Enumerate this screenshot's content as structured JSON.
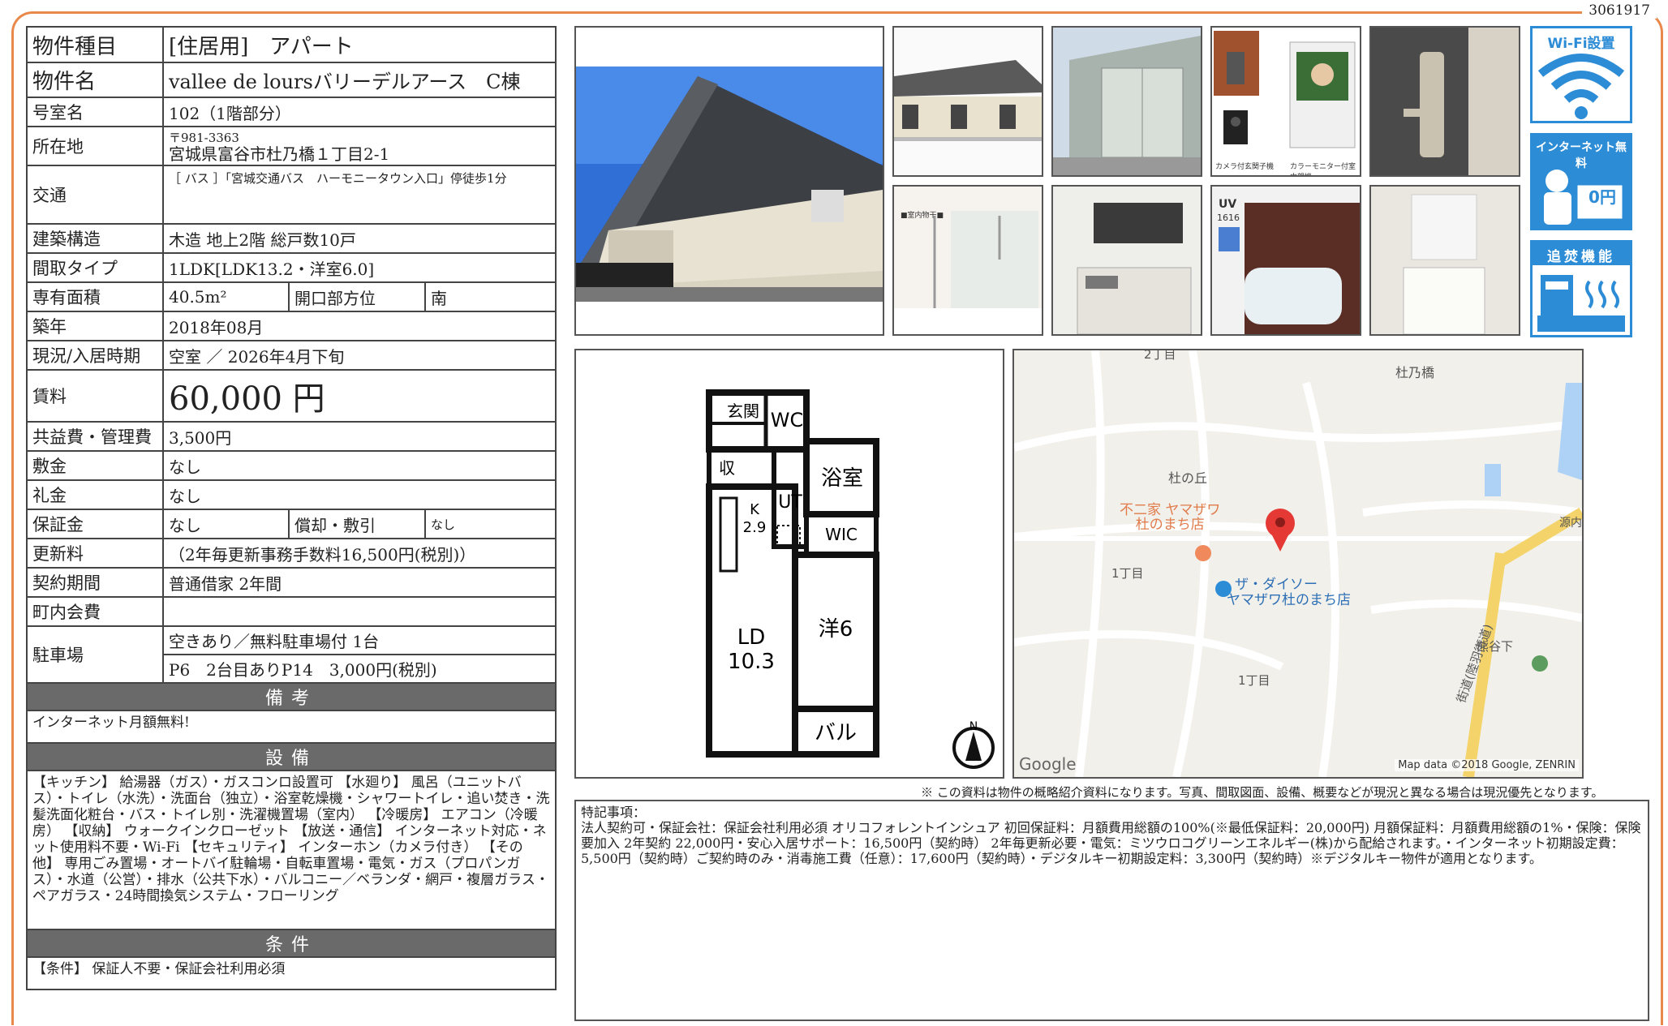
{
  "doc_id": "3061917",
  "labels": {
    "type": "物件種目",
    "name": "物件名",
    "room": "号室名",
    "address": "所在地",
    "transit": "交通",
    "structure": "建築構造",
    "layout": "間取タイプ",
    "area": "専有面積",
    "opening_dir": "開口部方位",
    "built": "築年",
    "status": "現況/入居時期",
    "rent": "賃料",
    "common_fee": "共益費・管理費",
    "deposit": "敷金",
    "key_money": "礼金",
    "guarantee": "保証金",
    "depreciation": "償却・敷引",
    "renewal": "更新料",
    "contract": "契約期間",
    "town_fee": "町内会費",
    "parking": "駐車場"
  },
  "values": {
    "type": "[住居用]　アパート",
    "name": "vallee de loursバリーデルアース　C棟",
    "room": "102（1階部分）",
    "postal": "〒981-3363",
    "address": "宮城県富谷市杜乃橋１丁目2-1",
    "transit": "［ バス ］「宮城交通バス　ハーモニータウン入口」停徒歩1分",
    "structure": "木造 地上2階 総戸数10戸",
    "layout": "1LDK[LDK13.2・洋室6.0]",
    "area": "40.5m²",
    "opening_dir": "南",
    "built": "2018年08月",
    "status": "空室 ／ 2026年4月下旬",
    "rent": "60,000 円",
    "common_fee": "3,500円",
    "deposit": "なし",
    "key_money": "なし",
    "guarantee": "なし",
    "depreciation": "なし",
    "renewal": "（2年毎更新事務手数料16,500円(税別)）",
    "contract": "普通借家 2年間",
    "town_fee": "",
    "parking_1": "空きあり／無料駐車場付 1台",
    "parking_2": "P6　2台目ありP14　3,000円(税別)"
  },
  "sections": {
    "remarks_title": "備考",
    "remarks": "インターネット月額無料!",
    "equipment_title": "設備",
    "equipment": "【キッチン】 給湯器（ガス）・ガスコンロ設置可 【水廻り】 風呂（ユニットバス）・トイレ（水洗）・洗面台（独立）・浴室乾燥機・シャワートイレ・追い焚き・洗髪洗面化粧台・バス・トイレ別・洗濯機置場（室内） 【冷暖房】 エアコン（冷暖房） 【収納】 ウォークインクローゼット 【放送・通信】 インターネット対応・ネット使用料不要・Wi-Fi 【セキュリティ】 インターホン（カメラ付き） 【その他】 専用ごみ置場・オートバイ駐輪場・自転車置場・電気・ガス（プロパンガス）・水道（公営）・排水（公共下水）・バルコニー／ベランダ・網戸・複層ガラス・ペアガラス・24時間換気システム・フローリング",
    "conditions_title": "条件",
    "conditions": "【条件】 保証人不要・保証会社利用必須"
  },
  "badges": {
    "wifi": "Wi-Fi設置",
    "internet": "インターネット無料",
    "internet_price": "0円",
    "reheat": "追焚機能"
  },
  "photo_captions": {
    "intercom_left": "カメラ付玄関子機",
    "intercom_right": "カラーモニター付室内親機",
    "indoor": "■室内物干■",
    "uv": "UV",
    "uv_num": "1616"
  },
  "floorplan": {
    "entrance": "玄関",
    "wc": "WC",
    "storage": "収",
    "bath": "浴室",
    "ut": "UT",
    "k": "K",
    "k_size": "2.9",
    "wic": "WIC",
    "ld": "LD",
    "ld_size": "10.3",
    "western": "洋6",
    "balcony": "バル",
    "north": "N"
  },
  "map": {
    "labels": [
      "2丁目",
      "杜乃橋",
      "杜の丘",
      "1丁目",
      "熊谷下",
      "1丁目",
      "源内"
    ],
    "shop1_line1": "不二家 ヤマザワ",
    "shop1_line2": "杜のまち店",
    "shop2_line1": "ザ・ダイソー",
    "shop2_line2": "ヤマザワ杜のまち店",
    "road": "街道(陸羽街道)",
    "google": "Google",
    "attribution": "Map data ©2018 Google, ZENRIN"
  },
  "disclaimer": "※ この資料は物件の概略紹介資料になります。写真、間取図面、設備、概要などが現況と異なる場合は現況優先となります。",
  "memo": {
    "title": "特記事項：",
    "body": "法人契約可・保証会社：保証会社利用必須 オリコフォレントインシュア 初回保証料：月額費用総額の100%(※最低保証料：20,000円) 月額保証料：月額費用総額の1%・保険：保険要加入 2年契約 22,000円・安心入居サポート：16,500円（契約時） 2年毎更新必要・電気：ミツウロコグリーンエネルギー(株)から配給されます。・インターネット初期設定費：5,500円（契約時）ご契約時のみ・消毒施工費（任意）：17,600円（契約時）・デジタルキー初期設定料：3,300円（契約時）※デジタルキー物件が適用となります。"
  },
  "colors": {
    "frame": "#e8884a",
    "section_bar": "#6a6a6a",
    "badge_blue": "#2c8cd6",
    "map_pin": "#e53935"
  }
}
